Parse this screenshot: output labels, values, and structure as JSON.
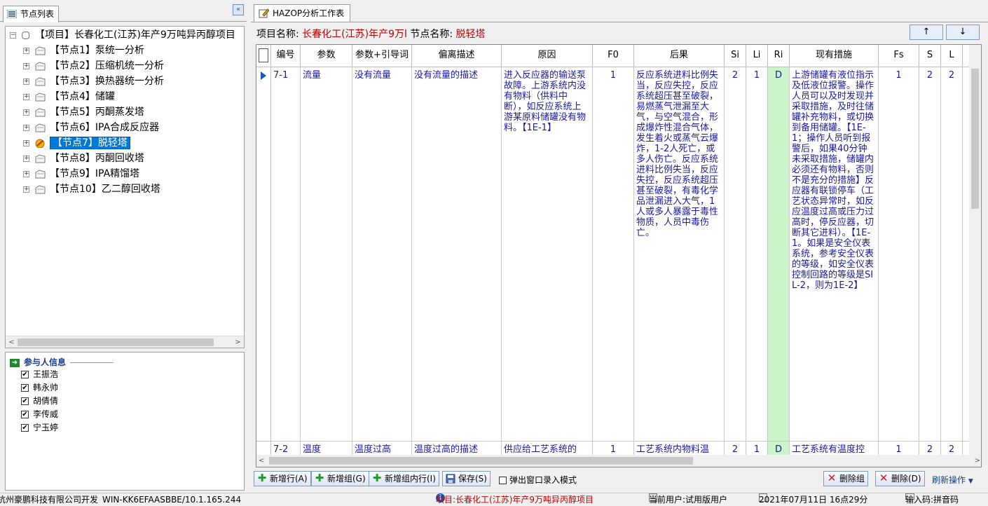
{
  "left_panel": {
    "tab_label": "节点列表",
    "collapse_button": "«",
    "tree": {
      "root_label": "【项目】长春化工(江苏)年产9万吨异丙醇项目",
      "nodes": [
        {
          "label": "【节点1】泵统一分析"
        },
        {
          "label": "【节点2】压缩机统一分析"
        },
        {
          "label": "【节点3】换热器统一分析"
        },
        {
          "label": "【节点4】储罐"
        },
        {
          "label": "【节点5】丙酮蒸发塔"
        },
        {
          "label": "【节点6】IPA合成反应器"
        },
        {
          "label": "【节点7】脱轻塔",
          "selected": true
        },
        {
          "label": "【节点8】丙酮回收塔"
        },
        {
          "label": "【节点9】IPA精馏塔"
        },
        {
          "label": "【节点10】乙二醇回收塔"
        }
      ]
    },
    "participants": {
      "title": "参与人信息",
      "people": [
        {
          "name": "王振浩",
          "checked": true
        },
        {
          "name": "韩永帅",
          "checked": true
        },
        {
          "name": "胡倩倩",
          "checked": true
        },
        {
          "name": "李传威",
          "checked": true
        },
        {
          "name": "宁玉婷",
          "checked": true
        }
      ]
    }
  },
  "right_panel": {
    "tab_label": "HAZOP分析工作表",
    "project_label": "项目名称:",
    "project_value": "长春化工(江苏)年产9万l",
    "node_label": "节点名称:",
    "node_value": "脱轻塔",
    "up_button": "↑",
    "down_button": "↓",
    "table": {
      "headers": [
        "编号",
        "参数",
        "参数+引导词",
        "偏离描述",
        "原因",
        "F0",
        "后果",
        "Si",
        "Li",
        "Ri",
        "现有措施",
        "Fs",
        "S",
        "L"
      ],
      "rows": [
        {
          "id": "7-1",
          "param": "流量",
          "guide": "没有流量",
          "deviation": "没有流量的描述",
          "cause": "进入反应器的输送泵故障。上游系统内没有物料（供料中断），如反应系统上游某原料储罐没有物料。【1E-1】",
          "f0": "1",
          "consequence": "反应系统进料比例失当，反应失控，反应系统超压甚至破裂，易燃蒸气泄漏至大气，与空气混合，形成爆炸性混合气体，发生着火或蒸气云爆炸，1-2人死亡，或多人伤亡。反应系统进料比例失当，反应失控，反应系统超压甚至破裂，有毒化学品泄漏进入大气，1人或多人暴露于毒性物质，人员中毒伤亡。",
          "si": "2",
          "li": "1",
          "ri": "D",
          "measures": "上游储罐有液位指示及低液位报警。操作人员可以及时发现并采取措施，及时往储罐补充物料，或切换到备用储罐。【1E-1；操作人员听到报警后，如果40分钟未采取措施，储罐内必须还有物料，否则不是充分的措施】反应器有联锁停车（工艺状态异常时，如反应温度过高或压力过高时，停反应器，切断其它进料）。【1E-1。如果是安全仪表系统，参考安全仪表的等级，如安全仪表控制回路的等级是SIL-2，则为1E-2】",
          "fs": "1",
          "s": "2",
          "l": "2"
        },
        {
          "id": "7-2",
          "param": "温度",
          "guide": "温度过高",
          "deviation": "温度过高的描述",
          "cause": "供应给工艺系统的",
          "f0": "1",
          "consequence": "工艺系统内物料温",
          "si": "2",
          "li": "1",
          "ri": "D",
          "measures": "工艺系统有温度控",
          "fs": "1",
          "s": "2",
          "l": "2"
        }
      ]
    },
    "buttons": {
      "add_row": "新增行(A)",
      "add_group": "新增组(G)",
      "add_group_row": "新增组内行(I)",
      "save": "保存(S)",
      "popup_mode": "弹出窗口录入模式",
      "delete_group": "删除组",
      "delete": "删除(D)",
      "refresh": "刷新操作"
    }
  },
  "status_bar": {
    "developer": "杭州豪鹏科技有限公司开发",
    "machine": "WIN-KK6EFAASBBE/10.1.165.244",
    "project": "项目:长春化工(江苏)年产9万吨异丙醇项目",
    "user": "当前用户:试用版用户",
    "datetime": "2021年07月11日 16点29分",
    "ime": "输入码:拼音码"
  },
  "colors": {
    "accent_red": "#c00000",
    "cell_blue": "#1a1aa0",
    "ri_green": "#ccf5cc",
    "selection": "#0078d7"
  }
}
